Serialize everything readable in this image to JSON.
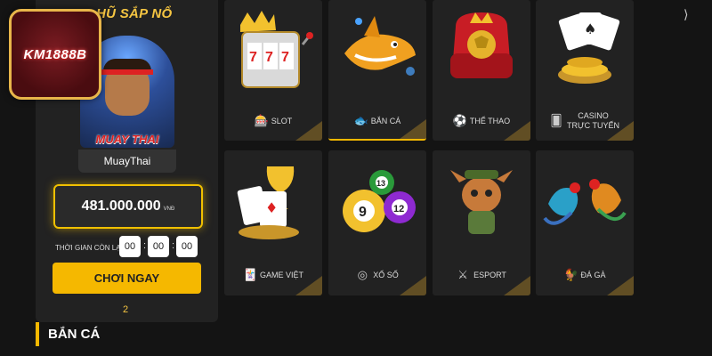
{
  "brand": {
    "logo_text": "KM1888B"
  },
  "jackpot": {
    "title": "HŨ SẮP NỔ",
    "game_art_text": "MUAY THAI",
    "game_name": "MuayThai",
    "amount": "481.000.000",
    "unit": "VNĐ",
    "timer_label": "THỜI GIAN CÒN LẠI:",
    "timer": [
      "00",
      "00",
      "00"
    ],
    "play_label": "CHƠI NGAY",
    "page": "2"
  },
  "section": {
    "title": "BẮN CÁ"
  },
  "categories": [
    {
      "label": "SLOT",
      "icon": "slot-machine-icon",
      "active": false
    },
    {
      "label": "BẮN CÁ",
      "icon": "fish-icon",
      "active": true
    },
    {
      "label": "THỂ THAO",
      "icon": "soccer-ball-icon",
      "active": false
    },
    {
      "label_line1": "CASINO",
      "label_line2": "TRỰC TUYẾN",
      "icon": "playing-card-icon",
      "active": false
    },
    {
      "label": "GAME VIỆT",
      "icon": "cards-icon",
      "active": false
    },
    {
      "label": "XỔ SỐ",
      "icon": "lottery-ball-icon",
      "active": false
    },
    {
      "label": "ESPORT",
      "icon": "crossed-swords-icon",
      "active": false
    },
    {
      "label": "ĐÁ GÀ",
      "icon": "rooster-icon",
      "active": false
    }
  ],
  "colors": {
    "accent": "#f5b800",
    "panel": "#222222",
    "background": "#141414"
  }
}
